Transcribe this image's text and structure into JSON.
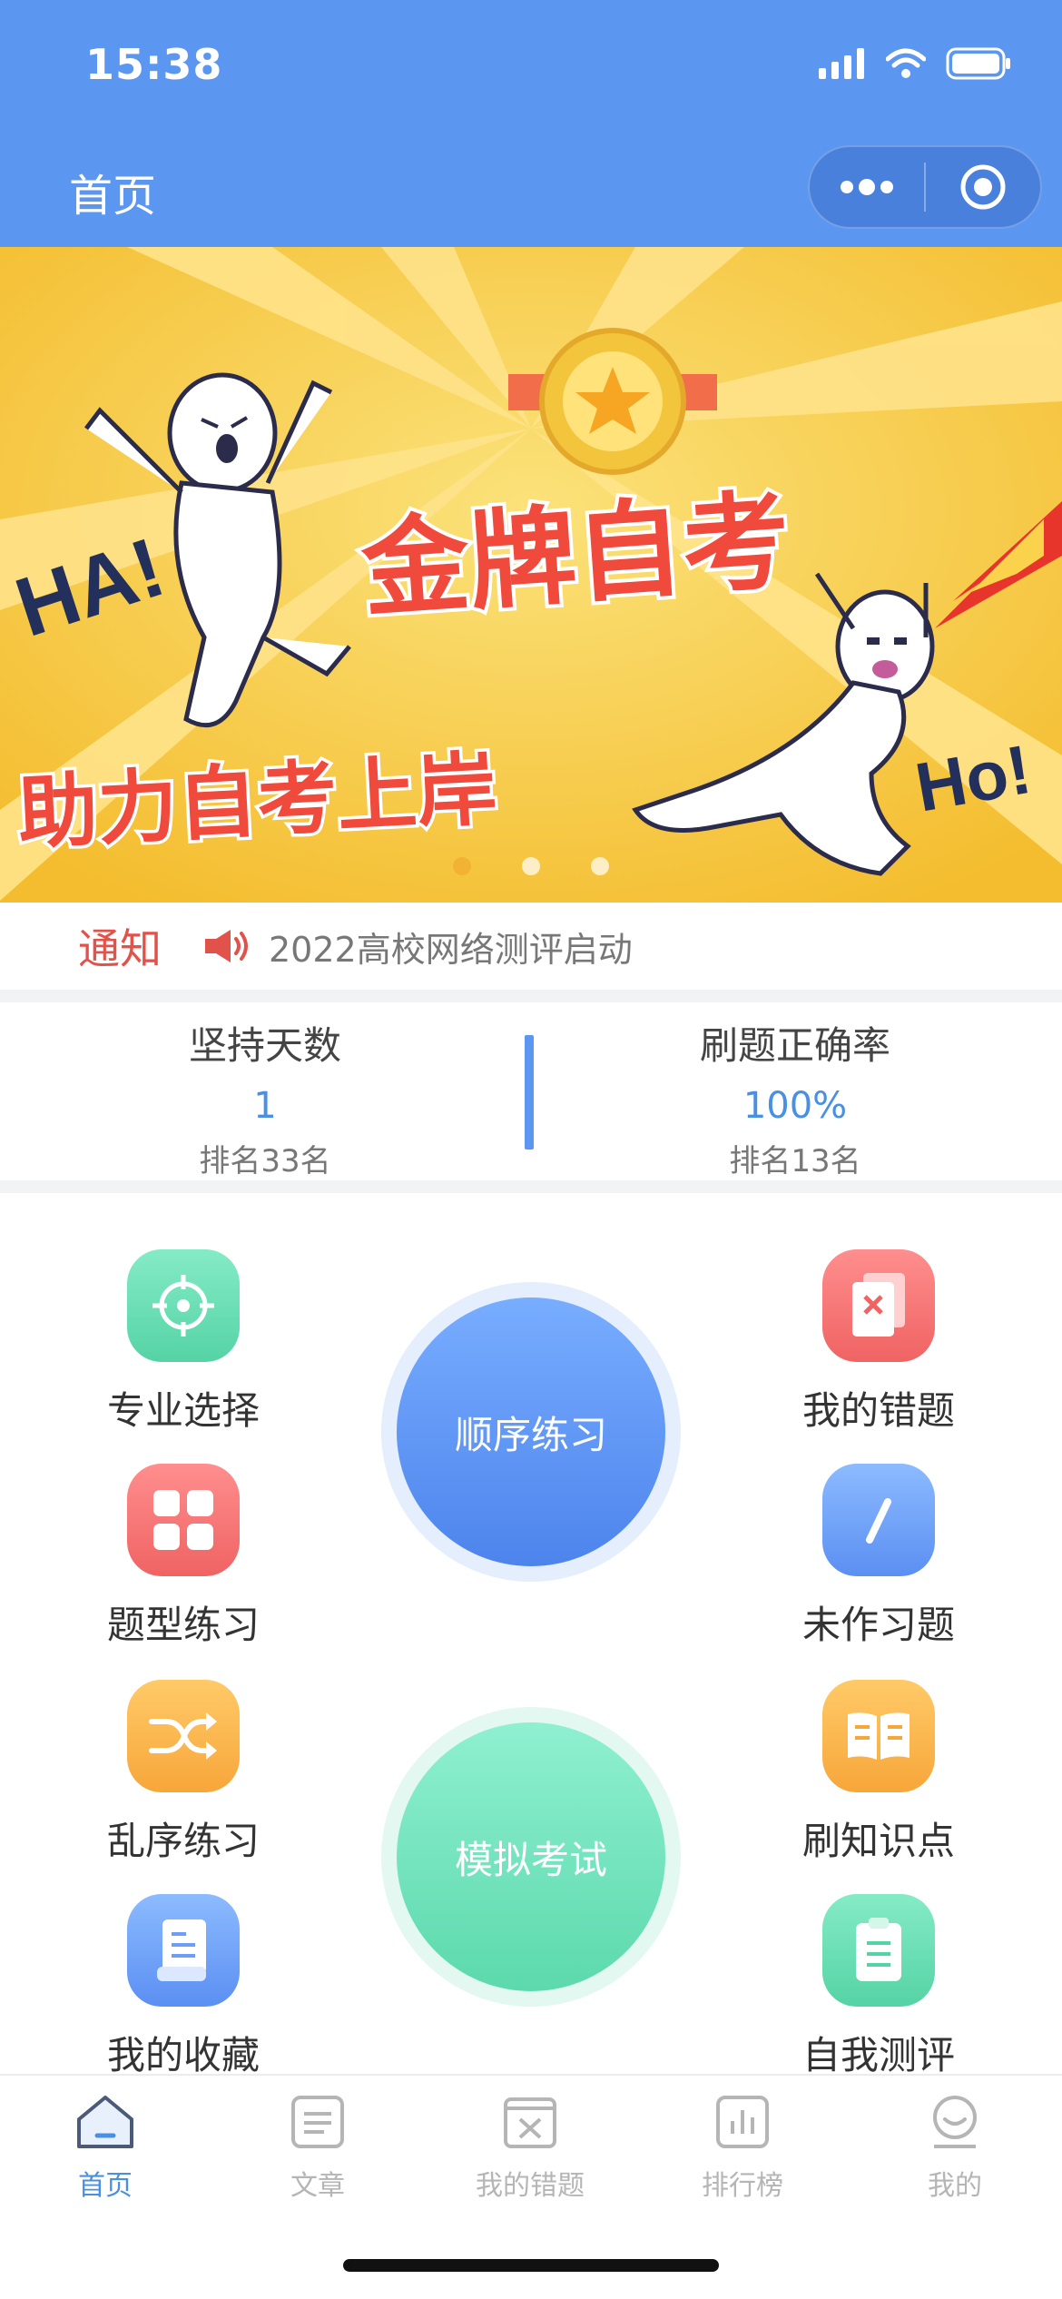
{
  "status_bar": {
    "time": "15:38"
  },
  "nav": {
    "title": "首页"
  },
  "banner": {
    "title": "金牌自考",
    "slogan": "助力自考上岸",
    "shout_left": "HA!",
    "shout_right": "Ho!",
    "slides": 3,
    "active_slide": 1
  },
  "notice": {
    "label": "通知",
    "text": "2022高校网络测评启动"
  },
  "stats": {
    "left": {
      "title": "坚持天数",
      "value": "1",
      "rank": "排名33名"
    },
    "right": {
      "title": "刷题正确率",
      "value": "100%",
      "rank": "排名13名"
    }
  },
  "grid": {
    "left": [
      {
        "label": "专业选择",
        "icon": "target-icon"
      },
      {
        "label": "题型练习",
        "icon": "grid-icon"
      },
      {
        "label": "乱序练习",
        "icon": "shuffle-icon"
      },
      {
        "label": "我的收藏",
        "icon": "document-icon"
      }
    ],
    "right": [
      {
        "label": "我的错题",
        "icon": "wrong-doc-icon"
      },
      {
        "label": "未作习题",
        "icon": "pencil-icon"
      },
      {
        "label": "刷知识点",
        "icon": "book-icon"
      },
      {
        "label": "自我测评",
        "icon": "clipboard-icon"
      }
    ],
    "center": [
      {
        "label": "顺序练习",
        "color": "#4d84ec"
      },
      {
        "label": "模拟考试",
        "color": "#5cd9ad"
      }
    ]
  },
  "tabbar": {
    "items": [
      {
        "label": "首页",
        "icon": "home-icon",
        "active": true
      },
      {
        "label": "文章",
        "icon": "article-icon",
        "active": false
      },
      {
        "label": "我的错题",
        "icon": "wrong-questions-icon",
        "active": false
      },
      {
        "label": "排行榜",
        "icon": "ranking-icon",
        "active": false
      },
      {
        "label": "我的",
        "icon": "profile-icon",
        "active": false
      }
    ]
  },
  "colors": {
    "primary": "#5b96f0",
    "accent_red": "#e0524a",
    "banner_yellow": "#f7c843"
  }
}
